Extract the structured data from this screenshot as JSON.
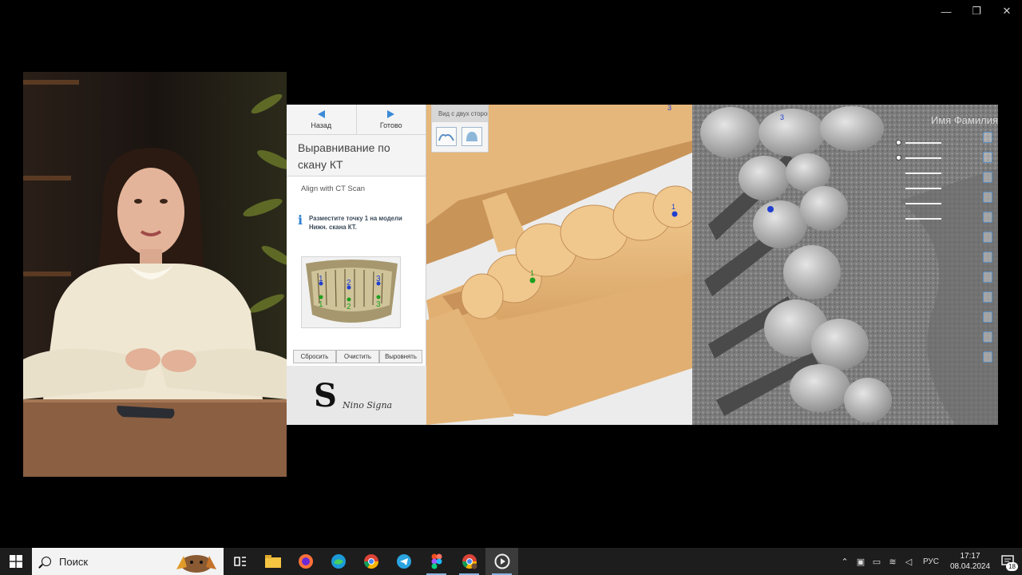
{
  "window_controls": {
    "minimize": "—",
    "restore": "❐",
    "close": "✕"
  },
  "wizard": {
    "back_label": "Назад",
    "done_label": "Готово",
    "title_line1": "Выравнивание по",
    "title_line2": "скану КТ",
    "subtitle": "Align with CT Scan",
    "instruction_line1": "Разместите точку 1 на модели",
    "instruction_line2": "Нижн. скана КТ.",
    "buttons": {
      "reset": "Сбросить",
      "clear": "Очистить",
      "align": "Выровнять"
    },
    "thumb_points": [
      "1",
      "2",
      "3",
      "1",
      "2",
      "3"
    ]
  },
  "view_panel": {
    "title": "Вид с двух сторон"
  },
  "model": {
    "point_labels": [
      "1",
      "1",
      "3"
    ]
  },
  "ct": {
    "name_label": "Имя Фамилия",
    "point_label": "3"
  },
  "signature": {
    "monogram": "S",
    "script": "Nino Signa"
  },
  "taskbar": {
    "search_placeholder": "Поиск",
    "apps": [
      "task-view",
      "file-explorer",
      "firefox",
      "edge",
      "chrome",
      "telegram",
      "figma",
      "chrome-profile",
      "media-player"
    ],
    "language": "РУС",
    "time": "17:17",
    "date": "08.04.2024",
    "notification_count": "18"
  },
  "colors": {
    "accent_blue": "#3a8ad8",
    "model_tan": "#e8b97a",
    "ct_gray": "#8c8c8c",
    "taskbar": "#1d1d1d"
  }
}
